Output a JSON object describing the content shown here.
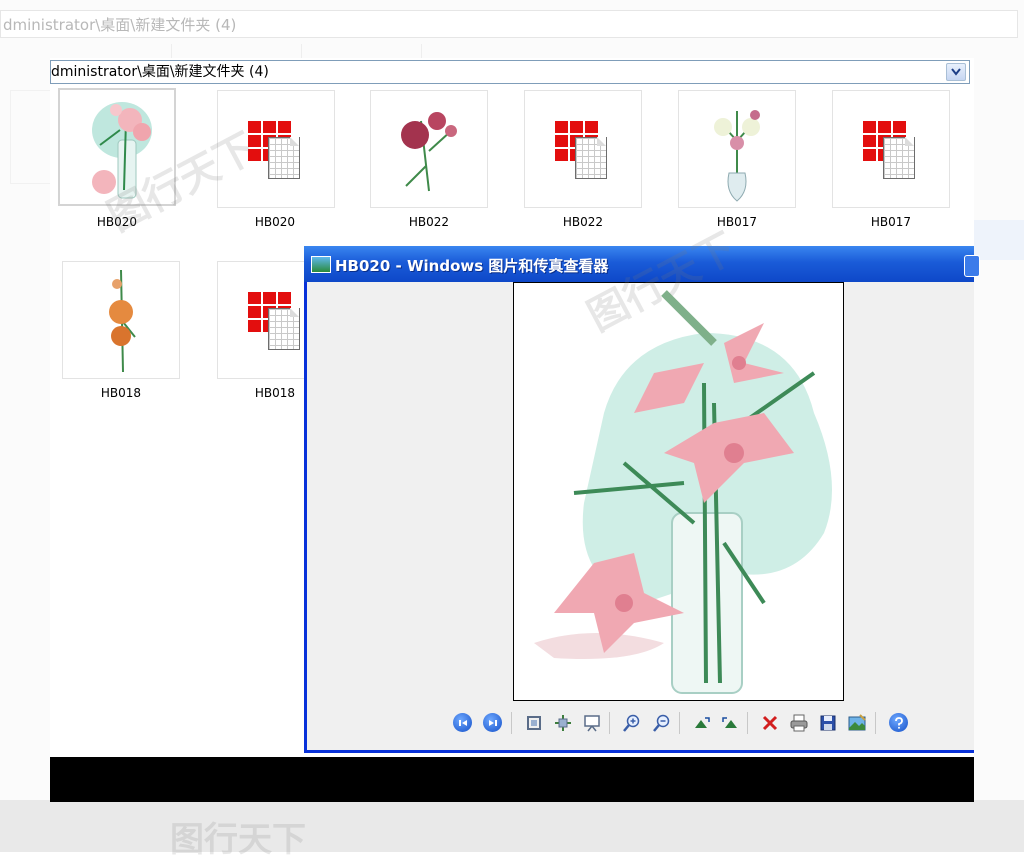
{
  "background_window": {
    "address_path": "dministrator\\桌面\\新建文件夹 (4)"
  },
  "explorer": {
    "address_path": "dministrator\\桌面\\新建文件夹 (4)",
    "items": [
      {
        "label": "HB020",
        "kind": "image-thumbnail",
        "selected": true
      },
      {
        "label": "HB020",
        "kind": "pattern-file"
      },
      {
        "label": "HB022",
        "kind": "image-thumbnail"
      },
      {
        "label": "HB022",
        "kind": "pattern-file"
      },
      {
        "label": "HB017",
        "kind": "image-thumbnail"
      },
      {
        "label": "HB017",
        "kind": "pattern-file"
      },
      {
        "label": "HB018",
        "kind": "image-thumbnail"
      },
      {
        "label": "HB018",
        "kind": "pattern-file"
      }
    ]
  },
  "viewer": {
    "title": "HB020 - Windows 图片和传真查看器",
    "toolbar": [
      {
        "icon": "previous-image-icon"
      },
      {
        "icon": "next-image-icon"
      },
      {
        "icon": "best-fit-icon"
      },
      {
        "icon": "actual-size-icon"
      },
      {
        "icon": "slideshow-icon"
      },
      {
        "icon": "zoom-in-icon"
      },
      {
        "icon": "zoom-out-icon"
      },
      {
        "icon": "rotate-clockwise-icon"
      },
      {
        "icon": "rotate-counterclockwise-icon"
      },
      {
        "icon": "delete-icon"
      },
      {
        "icon": "print-icon"
      },
      {
        "icon": "save-icon"
      },
      {
        "icon": "open-editor-icon"
      },
      {
        "icon": "help-icon"
      }
    ]
  },
  "colors": {
    "titlebar": "#1a5bd8",
    "selection_border": "#d4d4d4",
    "file_icon_red": "#e30e0e"
  }
}
